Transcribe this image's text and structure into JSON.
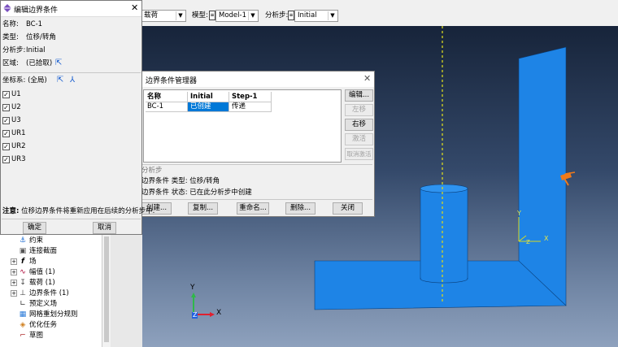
{
  "toolbar": {
    "step_select_value": "载荷",
    "model_label": "模型:",
    "model_value": "Model-1",
    "step_label": "分析步:",
    "step_value": "Initial"
  },
  "edit_dialog": {
    "title": "编辑边界条件",
    "name_label": "名称:",
    "name_value": "BC-1",
    "type_label": "类型:",
    "type_value": "位移/转角",
    "step_label": "分析步:",
    "step_value": "Initial",
    "region_label": "区域:",
    "region_value": "(已拾取)",
    "csys_label": "坐标系: (全局)",
    "dofs": [
      {
        "label": "U1",
        "checked": true
      },
      {
        "label": "U2",
        "checked": true
      },
      {
        "label": "U3",
        "checked": true
      },
      {
        "label": "UR1",
        "checked": true
      },
      {
        "label": "UR2",
        "checked": true
      },
      {
        "label": "UR3",
        "checked": true
      }
    ],
    "note_label": "注意:",
    "note_text": "位移边界条件将重新应用在后续的分析步中.",
    "ok_label": "确定",
    "cancel_label": "取消"
  },
  "manager_dialog": {
    "title": "边界条件管理器",
    "headers": [
      "名称",
      "Initial",
      "Step-1"
    ],
    "rows": [
      {
        "name": "BC-1",
        "initial": "已创建",
        "step1": "传递"
      }
    ],
    "side_buttons": [
      {
        "label": "编辑...",
        "enabled": true
      },
      {
        "label": "左移",
        "enabled": false
      },
      {
        "label": "右移",
        "enabled": true
      },
      {
        "label": "激活",
        "enabled": false
      },
      {
        "label": "取消激活",
        "enabled": false
      }
    ],
    "info_heading": "分析步",
    "info_line1": "边界条件 类型: 位移/转角",
    "info_line2": "边界条件 状态: 已在此分析步中创建",
    "bottom_buttons": [
      "创建...",
      "复制...",
      "重命名...",
      "删除...",
      "关闭"
    ],
    "selected_color": "#0078d7"
  },
  "tree": {
    "items": [
      {
        "label": "约束",
        "icon": "constraint-icon",
        "expandable": false
      },
      {
        "label": "连接截面",
        "icon": "connector-section-icon",
        "expandable": false
      },
      {
        "label": "场",
        "icon": "field-icon",
        "expandable": true
      },
      {
        "label": "幅值 (1)",
        "icon": "amplitude-icon",
        "expandable": true
      },
      {
        "label": "载荷 (1)",
        "icon": "load-icon",
        "expandable": true
      },
      {
        "label": "边界条件 (1)",
        "icon": "bc-icon",
        "expandable": true
      },
      {
        "label": "预定义场",
        "icon": "predefined-field-icon",
        "expandable": false
      },
      {
        "label": "网格重划分规则",
        "icon": "remesh-icon",
        "expandable": false
      },
      {
        "label": "优化任务",
        "icon": "optimization-icon",
        "expandable": false
      },
      {
        "label": "草图",
        "icon": "sketch-icon",
        "expandable": false
      }
    ]
  },
  "triad": {
    "x": "X",
    "y": "Y",
    "z": "Z"
  },
  "colors": {
    "part_blue": "#1e84e6",
    "part_edge": "#0a3f7a",
    "axis_x": "#e0202f",
    "axis_y": "#2fb84a",
    "axis_z": "#2060e0",
    "bc_marker": "#f07a1a",
    "model_axis": "#d8d820"
  }
}
